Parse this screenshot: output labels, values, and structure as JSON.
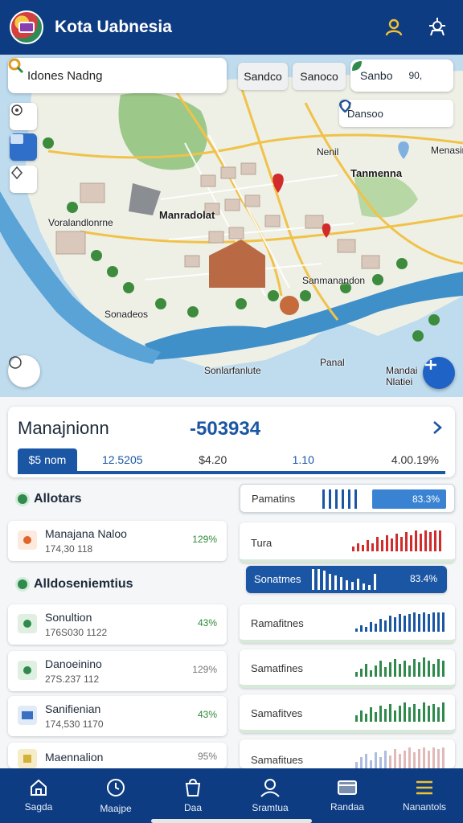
{
  "app": {
    "title": "Kota Uabnesia"
  },
  "map": {
    "search_text": "Idones Nadng",
    "chips": [
      "Sandco",
      "Sanoco"
    ],
    "chip_wide": {
      "label": "Sanbo",
      "value": "90,"
    },
    "filter_label": "Dansoo",
    "labels": {
      "tanamenna": "Tanmenna",
      "marandolat": "Manradolat",
      "vorlandlma": "Voralandlonrne",
      "salmendon": "Sanmanandon",
      "sonadeos": "Sonadeos",
      "somlarplute": "Sonlarfanlute",
      "pandl": "Panal",
      "mardai": "Mandai Nlatiei",
      "menasin": "Menasin",
      "nenil": "Nenil"
    }
  },
  "summary": {
    "title": "Manajnionn",
    "value": "-503934",
    "stats": [
      "$5 nom",
      "12.5205",
      "$4.20",
      "1.10",
      "4.00.19%"
    ]
  },
  "left": {
    "section1": "Allotars",
    "item1": {
      "name": "Manajana Naloo",
      "sub": "174,30 118",
      "pct": "129%"
    },
    "section2": "Alldoseniemtius",
    "items": [
      {
        "name": "Sonultion",
        "sub": "176S030 1122",
        "pct": "43%",
        "icon_color": "#2f8a4c"
      },
      {
        "name": "Danoeinino",
        "sub": "27S.237 112",
        "pct": "129%",
        "icon_color": "#2f8a4c"
      },
      {
        "name": "Sanifienian",
        "sub": "174,530 1170",
        "pct": "43%",
        "icon_color": "#3a6fc4"
      },
      {
        "name": "Maennalion",
        "sub": "",
        "pct": "95%",
        "icon_color": "#d4b23a"
      }
    ]
  },
  "right": {
    "metric_top": {
      "label": "Pamatins",
      "pct": "83.3%"
    },
    "metric2": {
      "label": "Tura"
    },
    "metric_hl": {
      "label": "Sonatmes",
      "pct": "83.4%"
    },
    "metrics": [
      "Ramafitnes",
      "Samatfines",
      "Samafitves",
      "Samafitues"
    ]
  },
  "nav": [
    "Sagda",
    "Maajpe",
    "Daa",
    "Sramtua",
    "Randaa",
    "Nanantols"
  ],
  "colors": {
    "primary": "#0d3c82",
    "accent": "#1b56a4",
    "green": "#2f8a4c",
    "red": "#d12b2b"
  }
}
